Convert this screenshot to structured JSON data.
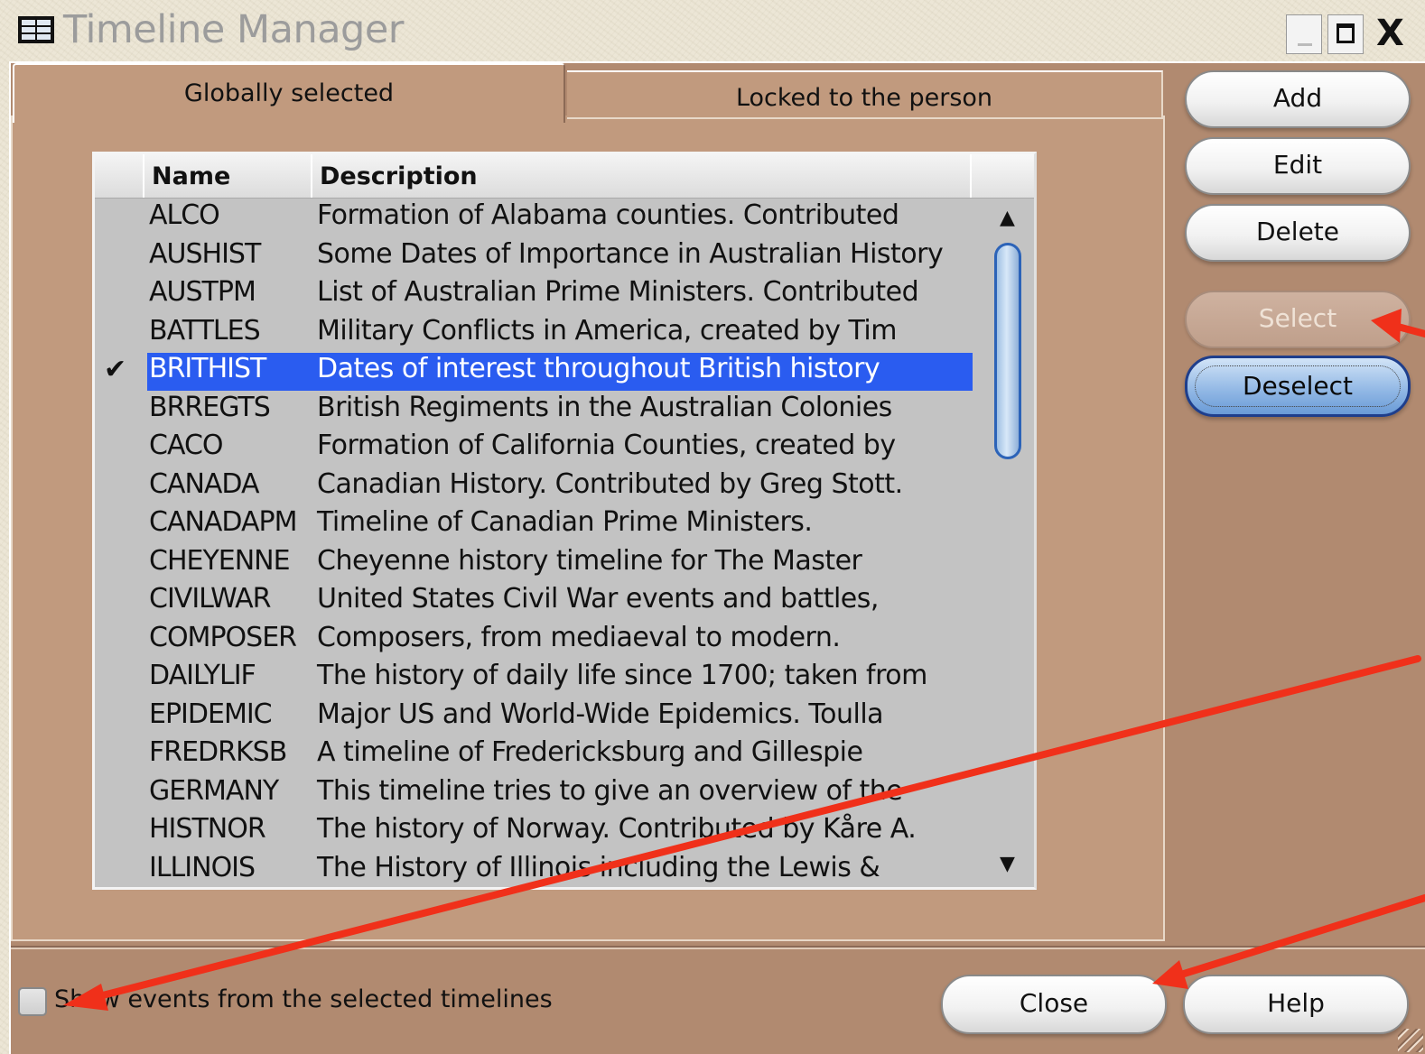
{
  "window": {
    "title": "Timeline Manager",
    "icon": "table-icon",
    "controls": [
      "minimize-icon",
      "maximize-icon",
      "close-icon"
    ],
    "close_glyph": "X"
  },
  "tabs": [
    {
      "label": "Globally selected",
      "active": true
    },
    {
      "label": "Locked to the person",
      "active": false
    }
  ],
  "list": {
    "columns": {
      "check": "",
      "name": "Name",
      "description": "Description"
    },
    "rows": [
      {
        "check": "",
        "name": "ALCO",
        "description": "Formation of Alabama counties.  Contributed"
      },
      {
        "check": "",
        "name": "AUSHIST",
        "description": "Some Dates of Importance in Australian History"
      },
      {
        "check": "",
        "name": "AUSTPM",
        "description": "List of Australian Prime Ministers.  Contributed"
      },
      {
        "check": "",
        "name": "BATTLES",
        "description": "Military Conflicts in America, created by Tim"
      },
      {
        "check": "✔",
        "name": "BRITHIST",
        "description": "Dates of interest throughout British history",
        "selected": true
      },
      {
        "check": "",
        "name": "BRREGTS",
        "description": "British Regiments in the Australian Colonies"
      },
      {
        "check": "",
        "name": "CACO",
        "description": "Formation of California Counties, created by"
      },
      {
        "check": "",
        "name": "CANADA",
        "description": "Canadian History.  Contributed by Greg Stott."
      },
      {
        "check": "",
        "name": "CANADAPM",
        "description": "Timeline of Canadian Prime Ministers."
      },
      {
        "check": "",
        "name": "CHEYENNE",
        "description": "Cheyenne history timeline for The Master"
      },
      {
        "check": "",
        "name": "CIVILWAR",
        "description": "United States Civil War events and battles,"
      },
      {
        "check": "",
        "name": "COMPOSER",
        "description": "Composers, from mediaeval to modern."
      },
      {
        "check": "",
        "name": "DAILYLIF",
        "description": "The history of daily life since 1700; taken from"
      },
      {
        "check": "",
        "name": "EPIDEMIC",
        "description": "Major US and World-Wide Epidemics.  Toulla"
      },
      {
        "check": "",
        "name": "FREDRKSB",
        "description": "A timeline of Fredericksburg and Gillespie"
      },
      {
        "check": "",
        "name": "GERMANY",
        "description": "This timeline tries to give an overview of the"
      },
      {
        "check": "",
        "name": "HISTNOR",
        "description": "The history of Norway. Contributed by Kåre A."
      },
      {
        "check": "",
        "name": "ILLINOIS",
        "description": "The History of Illinois including the Lewis &"
      }
    ],
    "scroll_up": "▲",
    "scroll_down": "▼"
  },
  "buttons": {
    "add": "Add",
    "edit": "Edit",
    "delete": "Delete",
    "select": "Select",
    "deselect": "Deselect",
    "close": "Close",
    "help": "Help"
  },
  "options": {
    "show_events_label": "Show events from the selected timelines",
    "show_events_checked": false
  },
  "colors": {
    "window_body": "#b18a70",
    "tab_panel": "#c19a7e",
    "list_background": "#c3c3c3",
    "selection": "#2a5cf0",
    "annotation_arrow": "#f0301a"
  }
}
